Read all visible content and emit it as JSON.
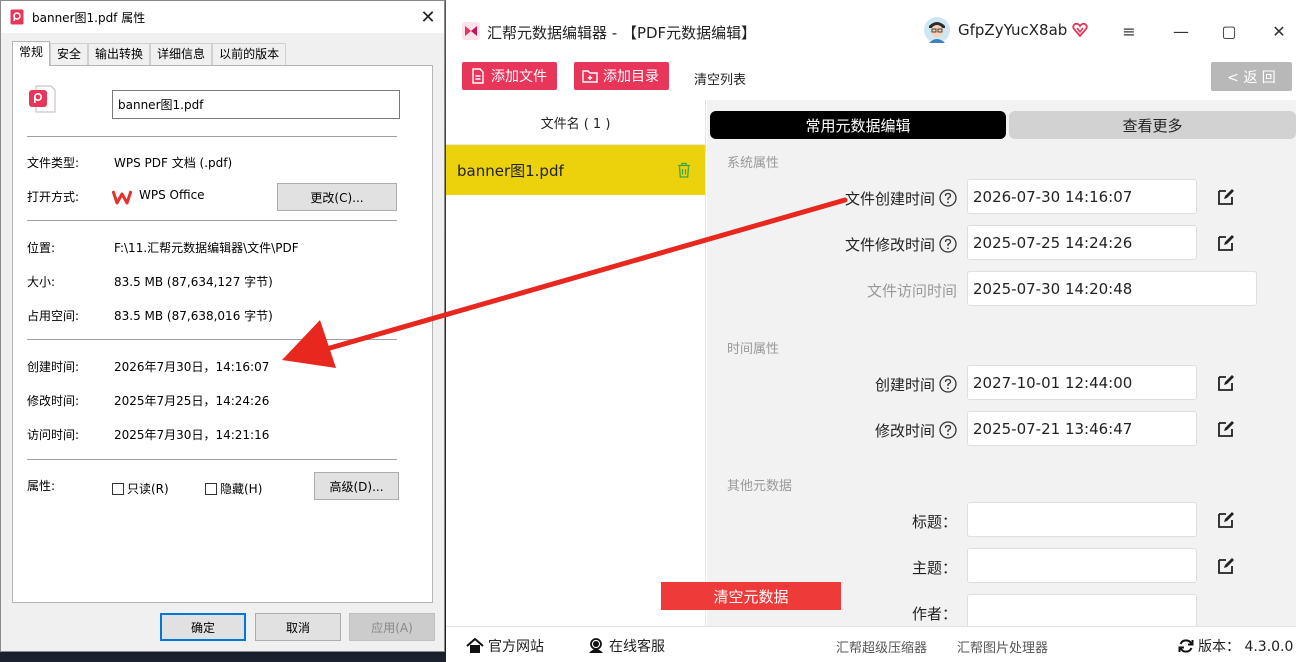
{
  "props": {
    "title": "banner图1.pdf 属性",
    "close": "✕",
    "tabs": [
      "常规",
      "安全",
      "输出转换",
      "详细信息",
      "以前的版本"
    ],
    "file_name": "banner图1.pdf",
    "type_label": "文件类型:",
    "type_value": "WPS PDF 文档 (.pdf)",
    "open_label": "打开方式:",
    "open_value": "WPS Office",
    "change_btn": "更改(C)...",
    "location_label": "位置:",
    "location_value": "F:\\11.汇帮元数据编辑器\\文件\\PDF",
    "size_label": "大小:",
    "size_value": "83.5 MB (87,634,127 字节)",
    "disk_label": "占用空间:",
    "disk_value": "83.5 MB (87,638,016 字节)",
    "created_label": "创建时间:",
    "created_value": "2026年7月30日，14:16:07",
    "modified_label": "修改时间:",
    "modified_value": "2025年7月25日，14:24:26",
    "accessed_label": "访问时间:",
    "accessed_value": "2025年7月30日，14:21:16",
    "attr_label": "属性:",
    "readonly": "只读(R)",
    "hidden": "隐藏(H)",
    "advanced_btn": "高级(D)...",
    "ok": "确定",
    "cancel": "取消",
    "apply": "应用(A)"
  },
  "app": {
    "title": "汇帮元数据编辑器 - 【PDF元数据编辑】",
    "username": "GfpZyYucX8ab",
    "menu_glyph": "≡",
    "min_glyph": "—",
    "max_glyph": "▢",
    "close_glyph": "✕",
    "add_file": "添加文件",
    "add_folder": "添加目录",
    "clear_list": "清空列表",
    "back": "< 返 回",
    "file_list_header": "文件名 ( 1 )",
    "files": [
      "banner图1.pdf"
    ],
    "tab_common": "常用元数据编辑",
    "tab_more": "查看更多",
    "sys_section": "系统属性",
    "sys_created_label": "文件创建时间",
    "sys_created_value": "2026-07-30 14:16:07",
    "sys_modified_label": "文件修改时间",
    "sys_modified_value": "2025-07-25 14:24:26",
    "sys_accessed_label": "文件访问时间",
    "sys_accessed_value": "2025-07-30 14:20:48",
    "time_section": "时间属性",
    "time_created_label": "创建时间",
    "time_created_value": "2027-10-01 12:44:00",
    "time_modified_label": "修改时间",
    "time_modified_value": "2025-07-21 13:46:47",
    "other_section": "其他元数据",
    "title_label": "标题：",
    "subject_label": "主题：",
    "author_label": "作者：",
    "clear_meta": "清空元数据",
    "official_site": "官方网站",
    "online_service": "在线客服",
    "link_compressor": "汇帮超级压缩器",
    "link_image": "汇帮图片处理器",
    "version": "版本： 4.3.0.0"
  },
  "colors": {
    "accent_pink": "#e8355a",
    "file_highlight": "#ebd20c",
    "clear_red": "#ef3a3a",
    "annotation_arrow": "#e8271e"
  }
}
